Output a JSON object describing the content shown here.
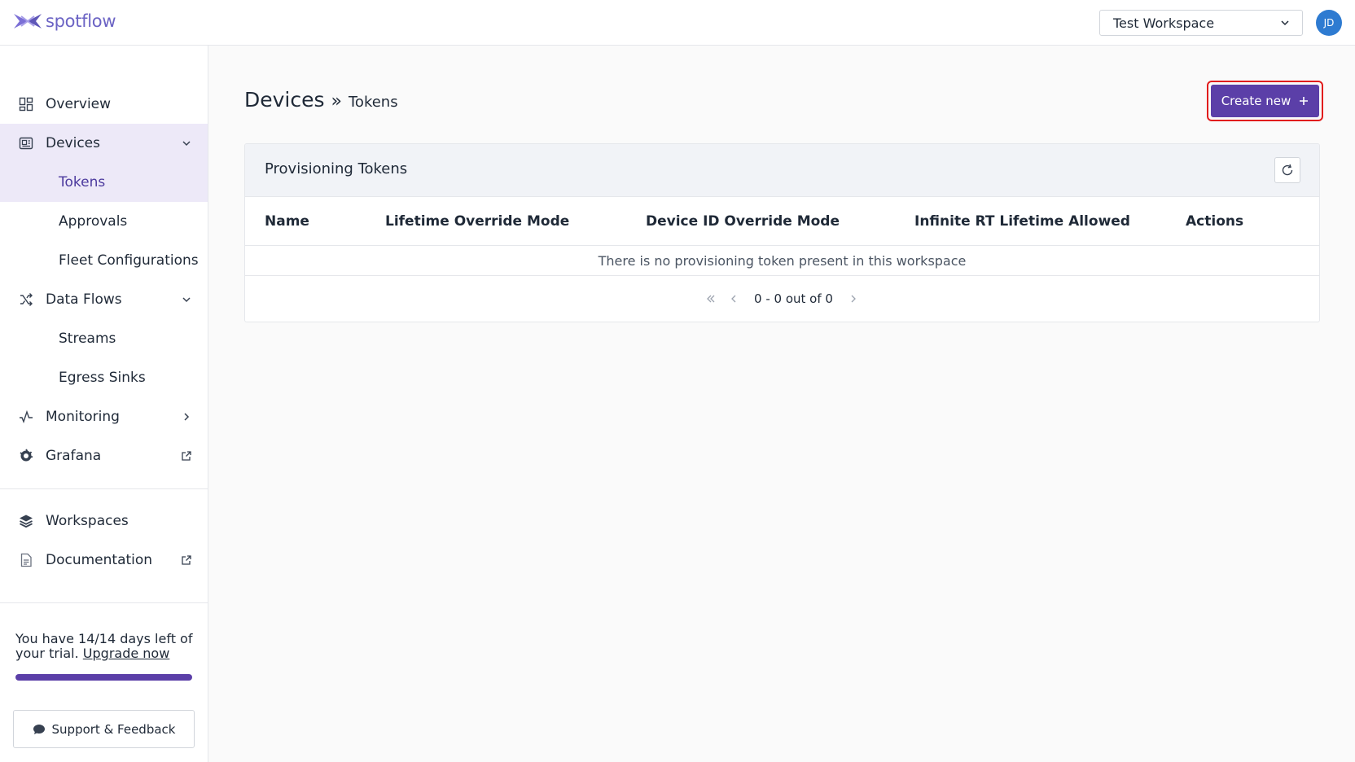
{
  "app": {
    "brand": "spotflow",
    "brand_color": "#6b63c4",
    "accent_color": "#5b3fa8"
  },
  "header": {
    "workspace_selector": {
      "value": "Test Workspace",
      "icon": "chevron-down-icon"
    },
    "avatar_initials": "JD"
  },
  "sidebar": {
    "items": [
      {
        "label": "Overview",
        "icon": "grid-icon"
      },
      {
        "label": "Devices",
        "icon": "device-icon",
        "expanded": true
      },
      {
        "label": "Tokens",
        "active": true
      },
      {
        "label": "Approvals"
      },
      {
        "label": "Fleet Configurations"
      },
      {
        "label": "Data Flows",
        "icon": "shuffle-icon",
        "expanded": true
      },
      {
        "label": "Streams"
      },
      {
        "label": "Egress Sinks"
      },
      {
        "label": "Monitoring",
        "icon": "pulse-icon"
      },
      {
        "label": "Grafana",
        "icon": "grafana-icon",
        "external": true
      }
    ],
    "bottom_items": [
      {
        "label": "Workspaces",
        "icon": "layers-icon"
      },
      {
        "label": "Documentation",
        "icon": "document-icon",
        "external": true
      }
    ],
    "trial": {
      "text": "You have 14/14 days left of your trial.",
      "link": "Upgrade now",
      "progress": 1.0
    },
    "support_label": "Support & Feedback"
  },
  "main": {
    "breadcrumb": {
      "section": "Devices",
      "separator": "»",
      "page": "Tokens"
    },
    "create_button_label": "Create new",
    "card": {
      "title": "Provisioning Tokens",
      "columns": [
        "Name",
        "Lifetime Override Mode",
        "Device ID Override Mode",
        "Infinite RT Lifetime Allowed",
        "Actions"
      ],
      "empty_message": "There is no provisioning token present in this workspace",
      "pagination": "0 - 0 out of 0"
    }
  }
}
